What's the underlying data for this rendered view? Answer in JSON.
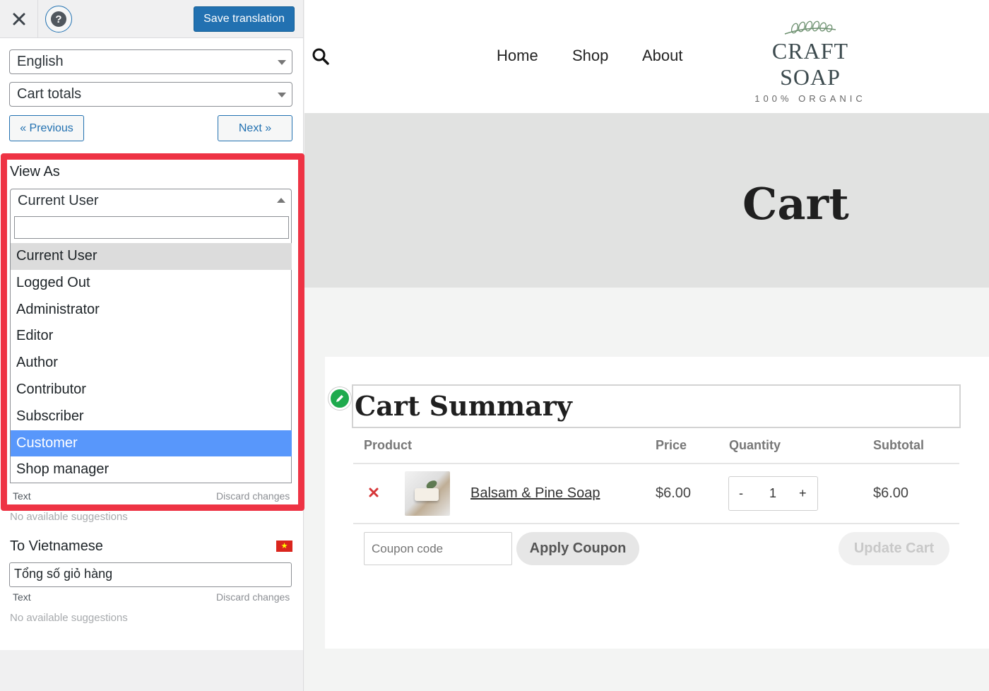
{
  "toolbar": {
    "close_icon": "close-icon",
    "help_icon": "help-icon",
    "help_glyph": "?",
    "save_label": "Save translation"
  },
  "language_select": {
    "value": "English"
  },
  "string_select": {
    "value": "Cart totals"
  },
  "nav": {
    "previous_label": "« Previous",
    "next_label": "Next »"
  },
  "view_as": {
    "label": "View As",
    "value": "Current User",
    "search_value": "",
    "options": [
      "Current User",
      "Logged Out",
      "Administrator",
      "Editor",
      "Author",
      "Contributor",
      "Subscriber",
      "Customer",
      "Shop manager"
    ],
    "hovered": "Current User",
    "highlighted": "Customer"
  },
  "source_field": {
    "type_label": "Text",
    "discard_label": "Discard changes",
    "suggestions": "No available suggestions"
  },
  "target_field": {
    "label": "To Vietnamese",
    "flag_icon": "vietnam-flag-icon",
    "value": "Tổng số giỏ hàng",
    "type_label": "Text",
    "discard_label": "Discard changes",
    "suggestions": "No available suggestions"
  },
  "site": {
    "search_icon": "search-icon",
    "menu": [
      "Home",
      "Shop",
      "About"
    ],
    "logo_title": "CRAFT SOAP",
    "logo_sub": "100% ORGANIC",
    "page_title": "Cart"
  },
  "cart": {
    "summary_title": "Cart Summary",
    "headers": {
      "product": "Product",
      "price": "Price",
      "quantity": "Quantity",
      "subtotal": "Subtotal"
    },
    "item": {
      "name": "Balsam & Pine Soap",
      "price": "$6.00",
      "qty_minus": "-",
      "qty": "1",
      "qty_plus": "+",
      "subtotal": "$6.00"
    },
    "coupon_placeholder": "Coupon code",
    "apply_label": "Apply Coupon",
    "update_label": "Update Cart"
  },
  "colors": {
    "accent_blue": "#2271b1",
    "highlight_red": "#ee3344",
    "selected_option": "#5897fb",
    "edit_green": "#1eaa4d"
  }
}
